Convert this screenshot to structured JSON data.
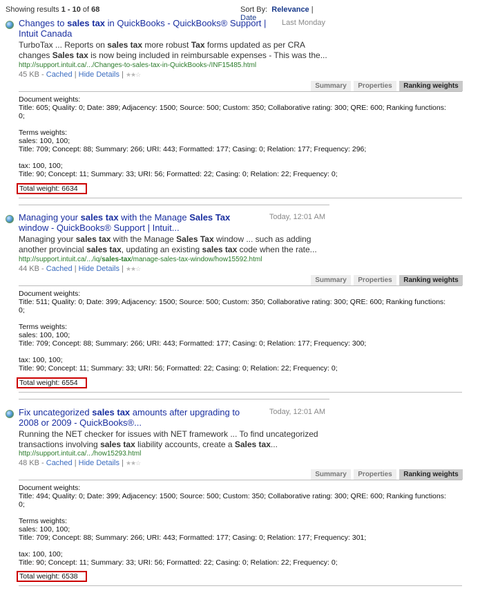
{
  "top": {
    "showing_prefix": "Showing results ",
    "range": "1 - 10",
    "of": " of ",
    "total": "68",
    "sort_label": "Sort By:",
    "sort_relevance": "Relevance",
    "sort_sep": "|",
    "sort_date": "Date"
  },
  "tabs": {
    "summary": "Summary",
    "properties": "Properties",
    "ranking": "Ranking weights"
  },
  "results": [
    {
      "title_1": "Changes to ",
      "title_b1": "sales tax",
      "title_2": " in QuickBooks - QuickBooks® Support |",
      "title_3": "Intuit Canada",
      "time": "Last Monday",
      "snip_a": "TurboTax ... Reports on ",
      "snip_b1": "sales tax",
      "snip_c": " more robust ",
      "snip_b2": "Tax",
      "snip_d": " forms updated as per CRA",
      "snip_e": "changes ",
      "snip_b3": "Sales tax",
      "snip_f": " is now being included in reimbursable expenses - This was the...",
      "url": "http://support.intuit.ca/.../Changes-to-sales-tax-in-QuickBooks-/INF15485.html",
      "size": "45 KB",
      "dash": " - ",
      "cached": "Cached",
      "pipe": " | ",
      "hide": "Hide Details",
      "pipe2": " |",
      "doc_label": "Document weights:",
      "doc_line1": "Title: 605; Quality: 0; Date: 389; Adjacency: 1500; Source: 500; Custom: 350; Collaborative rating: 300; QRE: 600; Ranking functions:",
      "doc_line2": "0;",
      "terms_label": "Terms weights:",
      "t1_head": "sales: 100, 100;",
      "t1_line": "Title: 709; Concept: 88; Summary: 266; URI: 443; Formatted: 177; Casing: 0; Relation: 177; Frequency: 296;",
      "t2_head": "tax: 100, 100;",
      "t2_line": "Title: 90; Concept: 11; Summary: 33; URI: 56; Formatted: 22; Casing: 0; Relation: 22; Frequency: 0;",
      "total": "Total weight: 6634"
    },
    {
      "title_1": "Managing your ",
      "title_b1": "sales tax",
      "title_2": " with the Manage ",
      "title_b2": "Sales Tax",
      "title_3": "window - QuickBooks® Support | Intuit...",
      "time": "Today, 12:01 AM",
      "snip_a": "Managing your ",
      "snip_b1": "sales tax",
      "snip_c": " with the Manage ",
      "snip_b2": "Sales Tax",
      "snip_d": " window ... such as adding",
      "snip_e": "another provincial ",
      "snip_b3": "sales tax",
      "snip_f": ", updating an existing ",
      "snip_b4": "sales tax",
      "snip_g": " code when the rate...",
      "url_1": "http://support.intuit.ca/.../iq/",
      "url_b": "sales-tax",
      "url_2": "/manage-sales-tax-window/how15592.html",
      "size": "44 KB",
      "dash": " - ",
      "cached": "Cached",
      "pipe": " | ",
      "hide": "Hide Details",
      "pipe2": " |",
      "doc_label": "Document weights:",
      "doc_line1": "Title: 511; Quality: 0; Date: 399; Adjacency: 1500; Source: 500; Custom: 350; Collaborative rating: 300; QRE: 600; Ranking functions:",
      "doc_line2": "0;",
      "terms_label": "Terms weights:",
      "t1_head": "sales: 100, 100;",
      "t1_line": "Title: 709; Concept: 88; Summary: 266; URI: 443; Formatted: 177; Casing: 0; Relation: 177; Frequency: 300;",
      "t2_head": "tax: 100, 100;",
      "t2_line": "Title: 90; Concept: 11; Summary: 33; URI: 56; Formatted: 22; Casing: 0; Relation: 22; Frequency: 0;",
      "total": "Total weight: 6554"
    },
    {
      "title_1": "Fix uncategorized ",
      "title_b1": "sales tax",
      "title_2": " amounts after upgrading to",
      "title_3": "2008 or 2009 - QuickBooks®...",
      "time": "Today, 12:01 AM",
      "snip_a": "Running the NET checker for issues with NET framework ... To find uncategorized",
      "snip_e": "transactions involving ",
      "snip_b3": "sales tax",
      "snip_f": " liability accounts, create a ",
      "snip_b4": "Sales tax",
      "snip_g": "...",
      "url": "http://support.intuit.ca/.../how15293.html",
      "size": "48 KB",
      "dash": " - ",
      "cached": "Cached",
      "pipe": " | ",
      "hide": "Hide Details",
      "pipe2": " |",
      "doc_label": "Document weights:",
      "doc_line1": "Title: 494; Quality: 0; Date: 399; Adjacency: 1500; Source: 500; Custom: 350; Collaborative rating: 300; QRE: 600; Ranking functions:",
      "doc_line2": "0;",
      "terms_label": "Terms weights:",
      "t1_head": "sales: 100, 100;",
      "t1_line": "Title: 709; Concept: 88; Summary: 266; URI: 443; Formatted: 177; Casing: 0; Relation: 177; Frequency: 301;",
      "t2_head": "tax: 100, 100;",
      "t2_line": "Title: 90; Concept: 11; Summary: 33; URI: 56; Formatted: 22; Casing: 0; Relation: 22; Frequency: 0;",
      "total": "Total weight: 6538"
    }
  ],
  "icons": {
    "result_icon": "globe-icon",
    "rating": "star-rating-icon"
  },
  "colors": {
    "title_link": "#1a2fa0",
    "url": "#2a7a2a",
    "highlight_box": "#cc0000",
    "active_tab": "#c9c9c9"
  }
}
